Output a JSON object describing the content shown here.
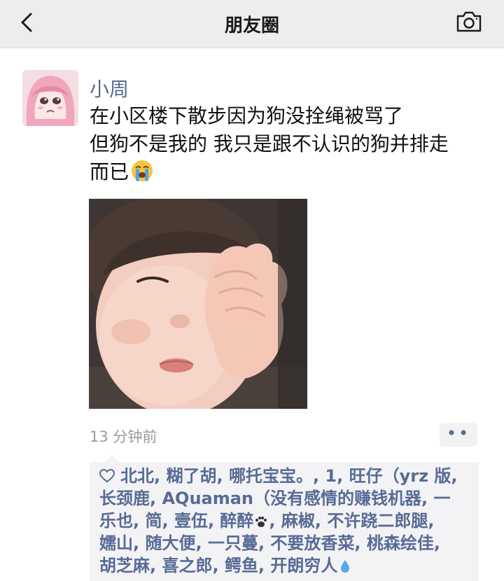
{
  "nav": {
    "title": "朋友圈",
    "back_icon": "chevron-left-icon",
    "camera_icon": "camera-icon"
  },
  "post": {
    "author": "小周",
    "text_line_1": "在小区楼下散步因为狗没拴绳被骂了",
    "text_line_2": "但狗不是我的 我只是跟不认识的狗并排走",
    "text_line_3": "而已",
    "emoji": "loudly-crying-face-icon",
    "time": "13 分钟前",
    "more_label": "••"
  },
  "likes": {
    "heart_icon": "heart-icon",
    "line_1": "北北, 糊了胡, 哪托宝宝。, 1, 旺仔（yrz 版,",
    "line_2": "长颈鹿, AQuaman（没有感情的赚钱机器, 一",
    "line_3a": "乐也, 简, 壹伍, 醉醉",
    "paw_icon": "paw-prints-icon",
    "line_3b": ", 麻椒, 不许跷二郎腿,",
    "line_4": "嬬山, 随大便, 一只蔓, 不要放香菜, 桃森绘佳,",
    "line_5": "胡芝麻, 喜之郎, 鳄鱼, 开朗穷人",
    "droplet_icon": "droplet-icon"
  },
  "colors": {
    "link": "#576b95",
    "nav_bg": "#ededed",
    "likes_bg": "#f3f3f5",
    "meta": "#9b9b9b"
  }
}
